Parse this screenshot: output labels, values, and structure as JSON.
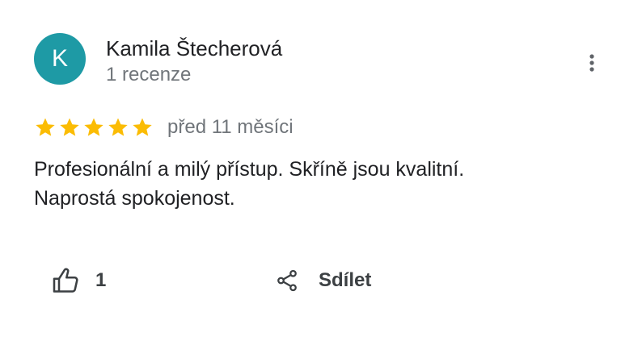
{
  "review": {
    "author": {
      "initial": "K",
      "avatar_color": "#1e9aa5",
      "name": "Kamila Štecherová",
      "meta": "1 recenze"
    },
    "more_icon": "more-vert-icon",
    "rating": {
      "stars": 5,
      "max": 5,
      "star_color": "#fbbc04"
    },
    "time": "před 11 měsíci",
    "text_lines": [
      "Profesionální a milý přístup. Skříně jsou kvalitní.",
      "Naprostá spokojenost."
    ],
    "actions": {
      "like": {
        "icon": "thumb-up-icon",
        "count": "1"
      },
      "share": {
        "icon": "share-icon",
        "label": "Sdílet"
      }
    }
  }
}
